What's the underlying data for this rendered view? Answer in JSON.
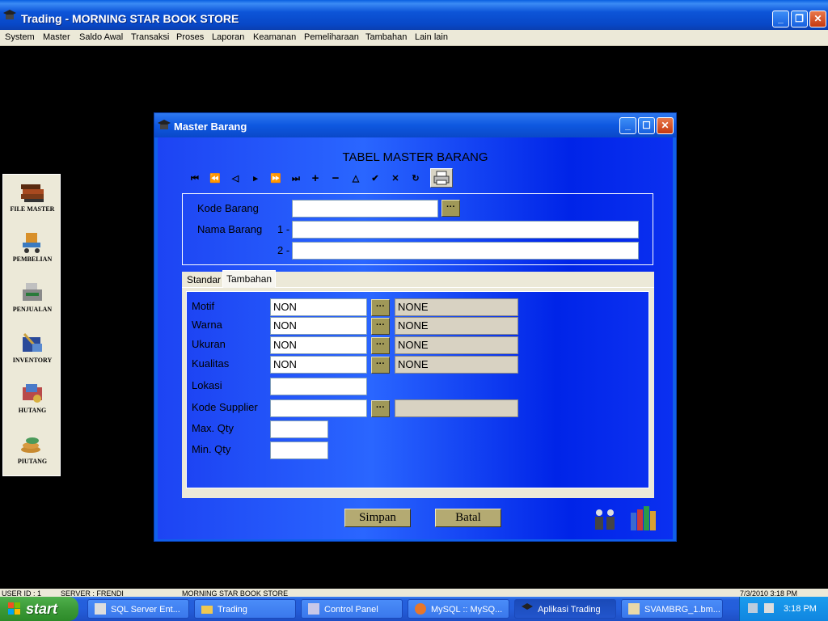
{
  "app": {
    "title": "Trading - MORNING STAR BOOK STORE",
    "menu": [
      "System",
      "Master",
      "Saldo Awal",
      "Transaksi",
      "Proses",
      "Laporan",
      "Keamanan",
      "Pemeliharaan",
      "Tambahan",
      "Lain lain"
    ]
  },
  "leftpanel": {
    "items": [
      {
        "label": "FILE MASTER",
        "icon": "books-icon"
      },
      {
        "label": "PEMBELIAN",
        "icon": "cart-icon"
      },
      {
        "label": "PENJUALAN",
        "icon": "cash-register-icon"
      },
      {
        "label": "INVENTORY",
        "icon": "inventory-icon"
      },
      {
        "label": "HUTANG",
        "icon": "payable-icon"
      },
      {
        "label": "PIUTANG",
        "icon": "coins-icon"
      }
    ]
  },
  "window": {
    "title": "Master Barang",
    "heading": "TABEL MASTER BARANG",
    "nav": [
      "first-icon",
      "prev-page-icon",
      "prev-icon",
      "next-icon",
      "next-page-icon",
      "last-icon",
      "add-icon",
      "delete-icon",
      "edit-icon",
      "confirm-icon",
      "cancel-icon",
      "refresh-icon",
      "print-icon"
    ],
    "kode_label": "Kode Barang",
    "nama_label": "Nama Barang",
    "nama_1": "1 -",
    "nama_2": "2 -",
    "kode_value": "",
    "nama1_value": "",
    "nama2_value": "",
    "tabs": [
      "Standar",
      "Tambahan"
    ],
    "active_tab": "Tambahan",
    "fields": {
      "motif": {
        "label": "Motif",
        "value": "NON",
        "desc": "NONE"
      },
      "warna": {
        "label": "Warna",
        "value": "NON",
        "desc": "NONE"
      },
      "ukuran": {
        "label": "Ukuran",
        "value": "NON",
        "desc": "NONE"
      },
      "kualitas": {
        "label": "Kualitas",
        "value": "NON",
        "desc": "NONE"
      },
      "lokasi": {
        "label": "Lokasi",
        "value": ""
      },
      "supplier": {
        "label": "Kode Supplier",
        "value": "",
        "desc": ""
      },
      "maxqty": {
        "label": "Max. Qty",
        "value": ""
      },
      "minqty": {
        "label": "Min. Qty",
        "value": ""
      }
    },
    "ellipsis": "···",
    "save": "Simpan",
    "cancel": "Batal"
  },
  "statusbar": {
    "user": "USER ID : 1",
    "server": "SERVER : FRENDI",
    "company": "MORNING STAR BOOK STORE",
    "datetime": "7/3/2010 3:18 PM"
  },
  "taskbar": {
    "start": "start",
    "tasks": [
      {
        "label": "SQL Server Ent...",
        "icon": "sql-server-icon"
      },
      {
        "label": "Trading",
        "icon": "folder-icon"
      },
      {
        "label": "Control Panel",
        "icon": "control-panel-icon"
      },
      {
        "label": "MySQL :: MySQ...",
        "icon": "firefox-icon"
      },
      {
        "label": "Aplikasi Trading",
        "icon": "app-icon"
      },
      {
        "label": "SVAMBRG_1.bm...",
        "icon": "paint-icon"
      }
    ],
    "clock": "3:18 PM"
  },
  "colors": {
    "xp_blue": "#0a48c8",
    "form_blue": "#2a66ff",
    "button_olive": "#b4aa72"
  }
}
